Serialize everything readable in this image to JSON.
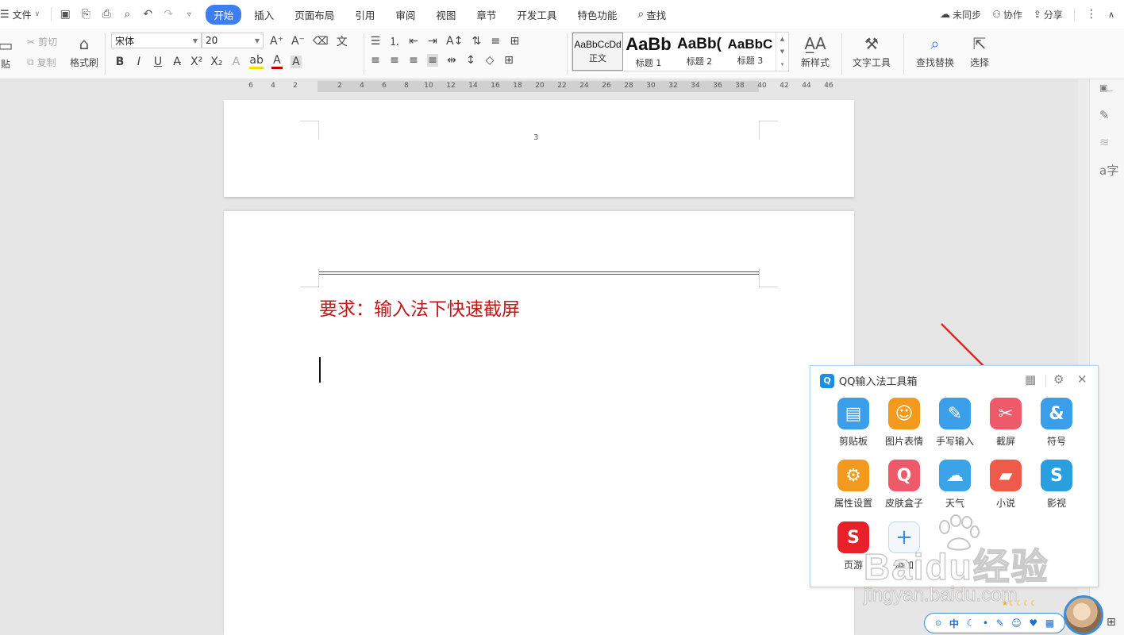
{
  "menubar": {
    "file_label": "文件",
    "tabs": [
      {
        "label": "开始",
        "active": true
      },
      {
        "label": "插入"
      },
      {
        "label": "页面布局"
      },
      {
        "label": "引用"
      },
      {
        "label": "审阅"
      },
      {
        "label": "视图"
      },
      {
        "label": "章节"
      },
      {
        "label": "开发工具"
      },
      {
        "label": "特色功能"
      }
    ],
    "search_label": "查找",
    "right": {
      "sync": "未同步",
      "collab": "协作",
      "share": "分享"
    }
  },
  "ribbon": {
    "paste": "贴",
    "cut": "剪切",
    "copy": "复制",
    "format_painter": "格式刷",
    "font_name": "宋体",
    "font_size": "20",
    "styles": [
      {
        "preview": "AaBbCcDd",
        "name": "正文",
        "selected": true
      },
      {
        "preview": "AaBb",
        "name": "标题 1"
      },
      {
        "preview": "AaBb(",
        "name": "标题 2"
      },
      {
        "preview": "AaBbC",
        "name": "标题 3"
      }
    ],
    "new_style": "新样式",
    "text_tools": "文字工具",
    "find_replace": "查找替换",
    "select": "选择"
  },
  "ruler": {
    "ticks": [
      "6",
      "4",
      "2",
      "2",
      "4",
      "6",
      "8",
      "10",
      "12",
      "14",
      "16",
      "18",
      "20",
      "22",
      "24",
      "26",
      "28",
      "30",
      "32",
      "34",
      "36",
      "38",
      "40",
      "42",
      "44",
      "46"
    ]
  },
  "document": {
    "page_number": "3",
    "title_text": "要求：输入法下快速截屏"
  },
  "qq_toolbox": {
    "title": "QQ输入法工具箱",
    "logo": "Q",
    "tools": [
      {
        "label": "剪贴板",
        "color": "#3b9ee8",
        "glyph": "▤"
      },
      {
        "label": "图片表情",
        "color": "#f39a1e",
        "glyph": "☺"
      },
      {
        "label": "手写输入",
        "color": "#3b9ee8",
        "glyph": "✎"
      },
      {
        "label": "截屏",
        "color": "#ef5a6a",
        "glyph": "✂"
      },
      {
        "label": "符号",
        "color": "#3b9ee8",
        "glyph": "&"
      },
      {
        "label": "属性设置",
        "color": "#f39a1e",
        "glyph": "⚙"
      },
      {
        "label": "皮肤盒子",
        "color": "#ef5a6a",
        "glyph": "Q"
      },
      {
        "label": "天气",
        "color": "#3ba3e8",
        "glyph": "☁"
      },
      {
        "label": "小说",
        "color": "#f05a4a",
        "glyph": "▰"
      },
      {
        "label": "影视",
        "color": "#2a9fe0",
        "glyph": "S"
      },
      {
        "label": "页游",
        "color": "#e8202a",
        "glyph": "S"
      },
      {
        "label": "添加",
        "color": "#f4f8fc",
        "glyph": "+"
      }
    ]
  },
  "ime_bar": {
    "items": [
      "中",
      "☾",
      "•",
      "✎",
      "☺",
      "♥",
      "▦"
    ]
  },
  "watermark": {
    "text": "Baidu经验",
    "url": "jingyan.baidu.com"
  }
}
